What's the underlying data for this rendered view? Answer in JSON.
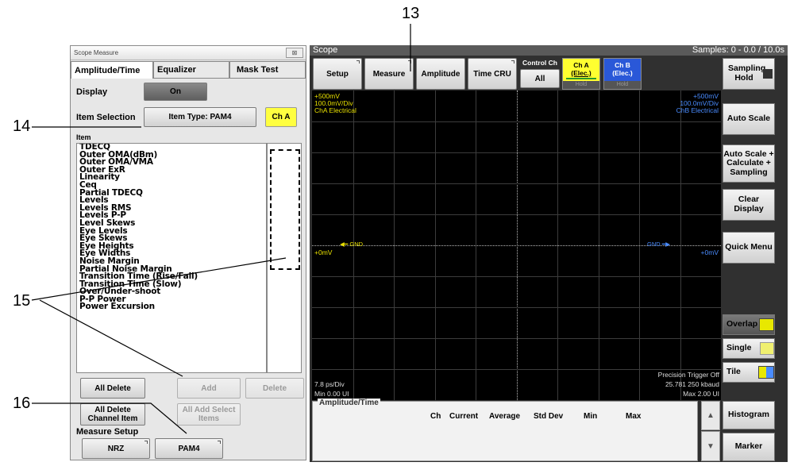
{
  "callouts": {
    "c13": "13",
    "c14": "14",
    "c15": "15",
    "c16": "16"
  },
  "panel": {
    "title": "Scope Measure",
    "close_glyph": "⊠",
    "tabs": [
      "Amplitude/Time",
      "Equalizer",
      "Mask Test"
    ],
    "display_label": "Display",
    "display_value": "On",
    "item_selection_label": "Item Selection",
    "item_type_button": "Item Type: PAM4",
    "channel_button": "Ch A",
    "item_header": "Item",
    "items": [
      "TDECQ",
      "Outer OMA(dBm)",
      "Outer OMA/VMA",
      "Outer ExR",
      "Linearity",
      "Ceq",
      "Partial TDECQ",
      "Levels",
      "Levels RMS",
      "Levels P-P",
      "Level Skews",
      "Eye Levels",
      "Eye Skews",
      "Eye Heights",
      "Eye Widths",
      "Noise Margin",
      "Partial Noise Margin",
      "Transition Time (Rise/Fall)",
      "Transition Time (Slow)",
      "Over/Under-shoot",
      "P-P Power",
      "Power Excursion"
    ],
    "buttons": {
      "all_delete": "All Delete",
      "add": "Add",
      "delete": "Delete",
      "all_delete_channel": "All Delete Channel Item",
      "all_add_select": "All Add Select Items",
      "nrz": "NRZ",
      "pam4": "PAM4"
    },
    "measure_setup_label": "Measure Setup"
  },
  "scope": {
    "title": "Scope",
    "samples": "Samples: 0 - 0.0 / 10.0s",
    "toolbar": {
      "setup": "Setup",
      "measure": "Measure",
      "amplitude": "Amplitude",
      "time_cru": "Time CRU",
      "control_ch": "Control Ch",
      "control_ch_value": "All",
      "cha_line1": "Ch A",
      "cha_line2": "(Elec.)",
      "chb_line1": "Ch B",
      "chb_line2": "(Elec.)",
      "hold": "Hold"
    },
    "plot": {
      "cha_top": "+500mV",
      "cha_scale": "100.0mV/Div",
      "cha_name": "ChA Electrical",
      "chb_top": "+500mV",
      "chb_scale": "100.0mV/Div",
      "chb_name": "ChB Electrical",
      "left_zero": "+0mV",
      "right_zero": "+0mV",
      "gnd": "GND",
      "time_div": "7.8 ps/Div",
      "min_ui": "Min 0.00 UI",
      "precision": "Precision Trigger Off",
      "rate": "25.781 250 kbaud",
      "max_ui": "Max 2.00 UI"
    },
    "measure_panel": {
      "title": "Amplitude/Time",
      "columns": [
        "Ch",
        "Current",
        "Average",
        "Std Dev",
        "Min",
        "Max"
      ]
    },
    "right": {
      "sampling_hold": "Sampling Hold",
      "auto_scale": "Auto Scale",
      "auto_scale_calc": "Auto Scale + Calculate + Sampling",
      "clear_display": "Clear Display",
      "quick_menu": "Quick Menu",
      "overlap": "Overlap",
      "single": "Single",
      "tile": "Tile",
      "histogram": "Histogram",
      "marker": "Marker"
    }
  }
}
